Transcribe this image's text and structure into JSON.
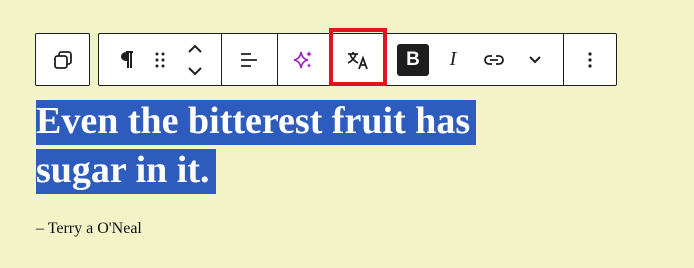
{
  "toolbar": {
    "buttons": [
      {
        "name": "transform-block",
        "icon": "duplicate-icon"
      },
      {
        "name": "paragraph-type",
        "icon": "pilcrow-icon"
      },
      {
        "name": "drag-handle",
        "icon": "drag-icon"
      },
      {
        "name": "move-up",
        "icon": "chevron-up-icon"
      },
      {
        "name": "move-down",
        "icon": "chevron-down-icon"
      },
      {
        "name": "align",
        "icon": "align-left-icon"
      },
      {
        "name": "ai-assistant",
        "icon": "sparkle-icon"
      },
      {
        "name": "translate",
        "icon": "translate-icon"
      },
      {
        "name": "bold",
        "label": "B"
      },
      {
        "name": "italic",
        "label": "I"
      },
      {
        "name": "link",
        "icon": "link-icon"
      },
      {
        "name": "more-rich-text",
        "icon": "chevron-down-icon"
      },
      {
        "name": "options",
        "icon": "more-vertical-icon"
      }
    ],
    "bold_label": "B",
    "italic_label": "I",
    "colors": {
      "accent_highlight": "#e0141e",
      "sparkle": "#a020c8",
      "bold_bg": "#1e1e1e"
    }
  },
  "content": {
    "quote_line1": "Even the bitterest fruit has",
    "quote_line2": "sugar in it.",
    "citation": "– Terry a O'Neal",
    "selection_color": "#2d5cbe"
  }
}
